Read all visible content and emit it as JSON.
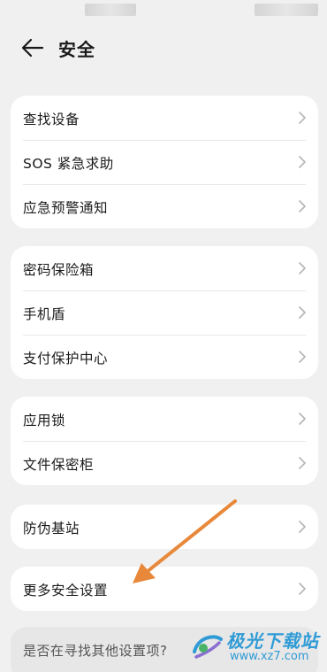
{
  "header": {
    "title": "安全"
  },
  "groups": [
    {
      "items": [
        {
          "label": "查找设备"
        },
        {
          "label": "SOS 紧急求助"
        },
        {
          "label": "应急预警通知"
        }
      ]
    },
    {
      "items": [
        {
          "label": "密码保险箱"
        },
        {
          "label": "手机盾"
        },
        {
          "label": "支付保护中心"
        }
      ]
    },
    {
      "items": [
        {
          "label": "应用锁"
        },
        {
          "label": "文件保密柜"
        }
      ]
    },
    {
      "items": [
        {
          "label": "防伪基站"
        }
      ]
    },
    {
      "items": [
        {
          "label": "更多安全设置"
        }
      ]
    }
  ],
  "suggest": {
    "text": "是否在寻找其他设置项?"
  },
  "watermark": {
    "name": "极光下载站",
    "url": "www.xz7.com"
  },
  "colors": {
    "annotation_arrow": "#e8883a",
    "watermark": "#2f9bd6"
  }
}
